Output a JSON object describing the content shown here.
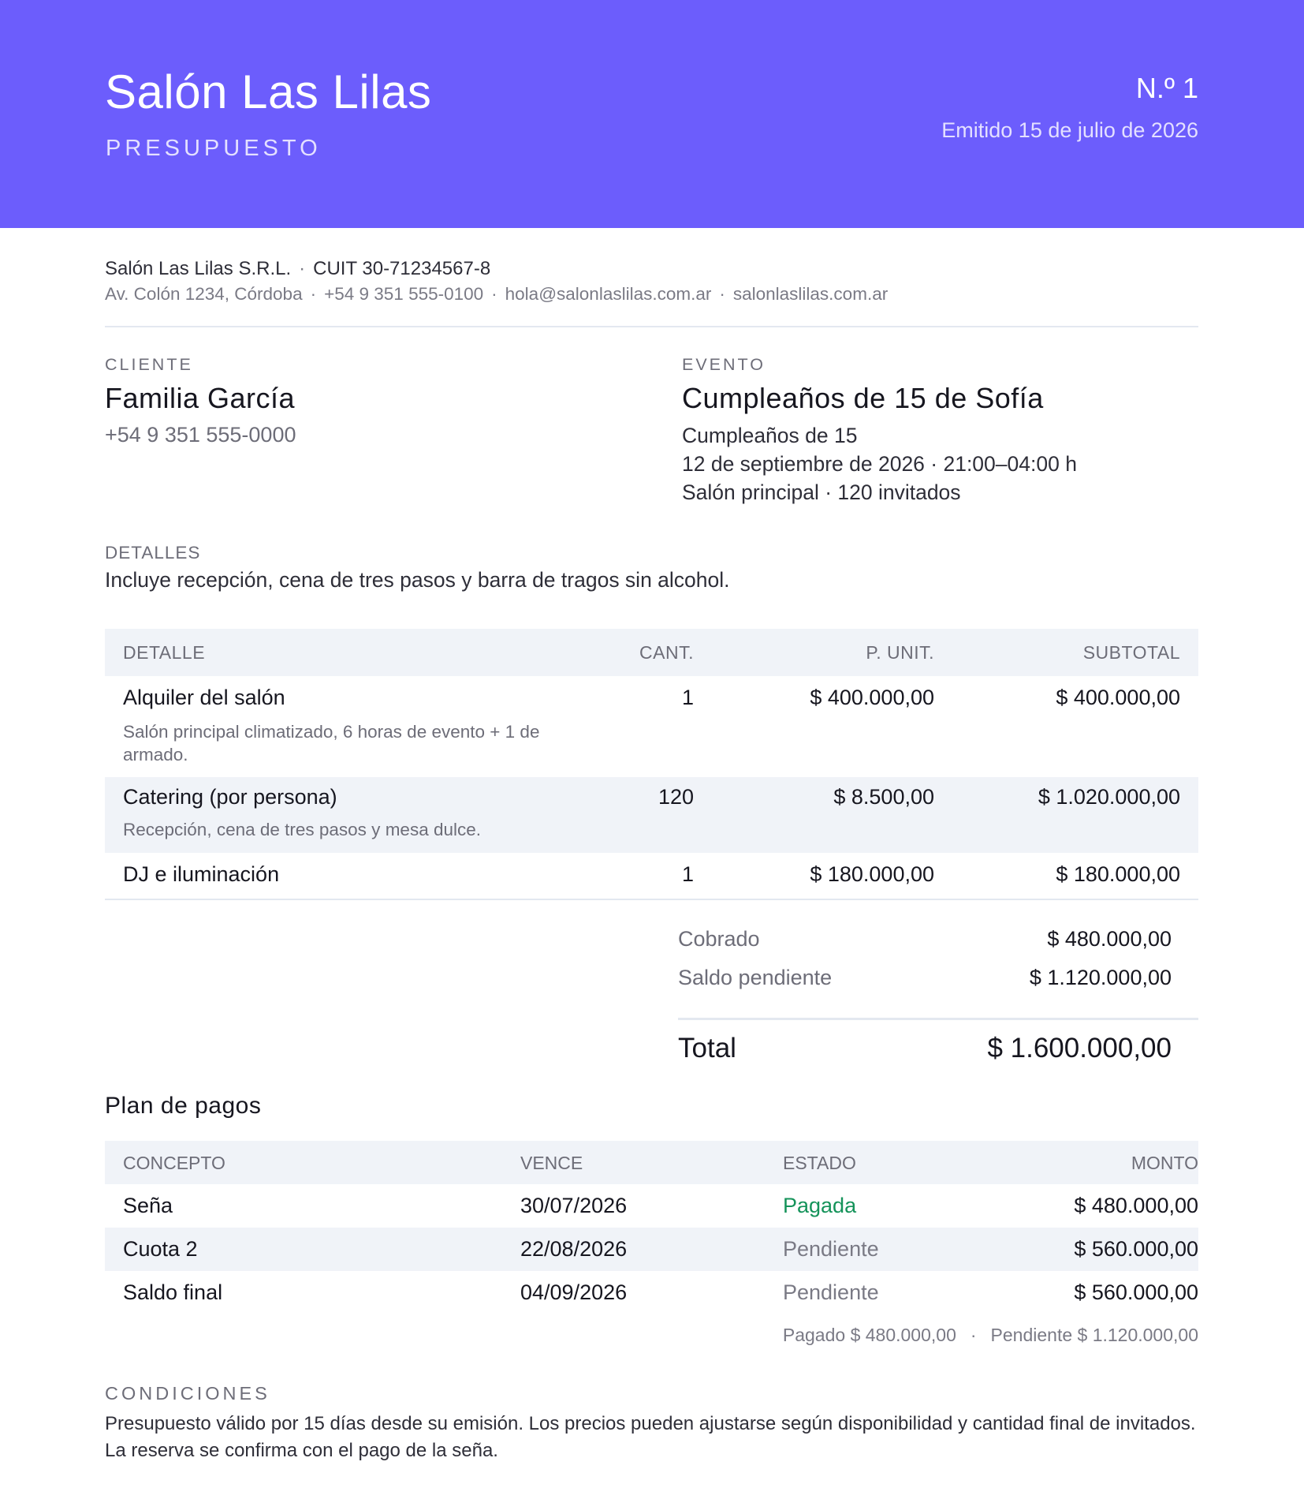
{
  "header": {
    "brand": "Salón Las Lilas",
    "doc_type": "PRESUPUESTO",
    "number": "N.º 1",
    "issued": "Emitido 15 de julio de 2026",
    "accent_color": "#6c5dfc"
  },
  "company": {
    "legal_name": "Salón Las Lilas S.R.L.",
    "tax_id": "CUIT 30-71234567-8",
    "address": "Av. Colón 1234, Córdoba",
    "phone": "+54 9 351 555-0100",
    "email": "hola@salonlaslilas.com.ar",
    "website": "salonlaslilas.com.ar",
    "separator": "·"
  },
  "client": {
    "label": "CLIENTE",
    "name": "Familia García",
    "phone": "+54 9 351 555-0000"
  },
  "event": {
    "label": "EVENTO",
    "title": "Cumpleaños de 15 de Sofía",
    "type": "Cumpleaños de 15",
    "datetime": "12 de septiembre de 2026 · 21:00–04:00 h",
    "venue": "Salón principal · 120 invitados"
  },
  "details": {
    "label": "DETALLES",
    "text": "Incluye recepción, cena de tres pasos y barra de tragos sin alcohol."
  },
  "items_table": {
    "headers": {
      "detail": "DETALLE",
      "qty": "CANT.",
      "unit": "P. UNIT.",
      "subtotal": "SUBTOTAL"
    },
    "rows": [
      {
        "name": "Alquiler del salón",
        "desc": "Salón principal climatizado, 6 horas de evento + 1 de armado.",
        "qty": "1",
        "unit": "$ 400.000,00",
        "subtotal": "$ 400.000,00"
      },
      {
        "name": "Catering (por persona)",
        "desc": "Recepción, cena de tres pasos y mesa dulce.",
        "qty": "120",
        "unit": "$ 8.500,00",
        "subtotal": "$ 1.020.000,00"
      },
      {
        "name": "DJ e iluminación",
        "desc": "",
        "qty": "1",
        "unit": "$ 180.000,00",
        "subtotal": "$ 180.000,00"
      }
    ]
  },
  "totals": {
    "collected_label": "Cobrado",
    "collected": "$ 480.000,00",
    "pending_label": "Saldo pendiente",
    "pending": "$ 1.120.000,00",
    "total_label": "Total",
    "total": "$ 1.600.000,00"
  },
  "payment_plan": {
    "title": "Plan de pagos",
    "headers": {
      "concept": "CONCEPTO",
      "due": "VENCE",
      "status": "ESTADO",
      "amount": "MONTO"
    },
    "rows": [
      {
        "concept": "Seña",
        "due": "30/07/2026",
        "status": "Pagada",
        "amount": "$ 480.000,00"
      },
      {
        "concept": "Cuota 2",
        "due": "22/08/2026",
        "status": "Pendiente",
        "amount": "$ 560.000,00"
      },
      {
        "concept": "Saldo final",
        "due": "04/09/2026",
        "status": "Pendiente",
        "amount": "$ 560.000,00"
      }
    ],
    "summary_paid": "Pagado $ 480.000,00",
    "summary_pending": "Pendiente $ 1.120.000,00",
    "paid_color": "#15935a"
  },
  "conditions": {
    "label": "CONDICIONES",
    "text": "Presupuesto válido por 15 días desde su emisión. Los precios pueden ajustarse según disponibilidad y cantidad final de invitados. La reserva se confirma con el pago de la seña."
  }
}
